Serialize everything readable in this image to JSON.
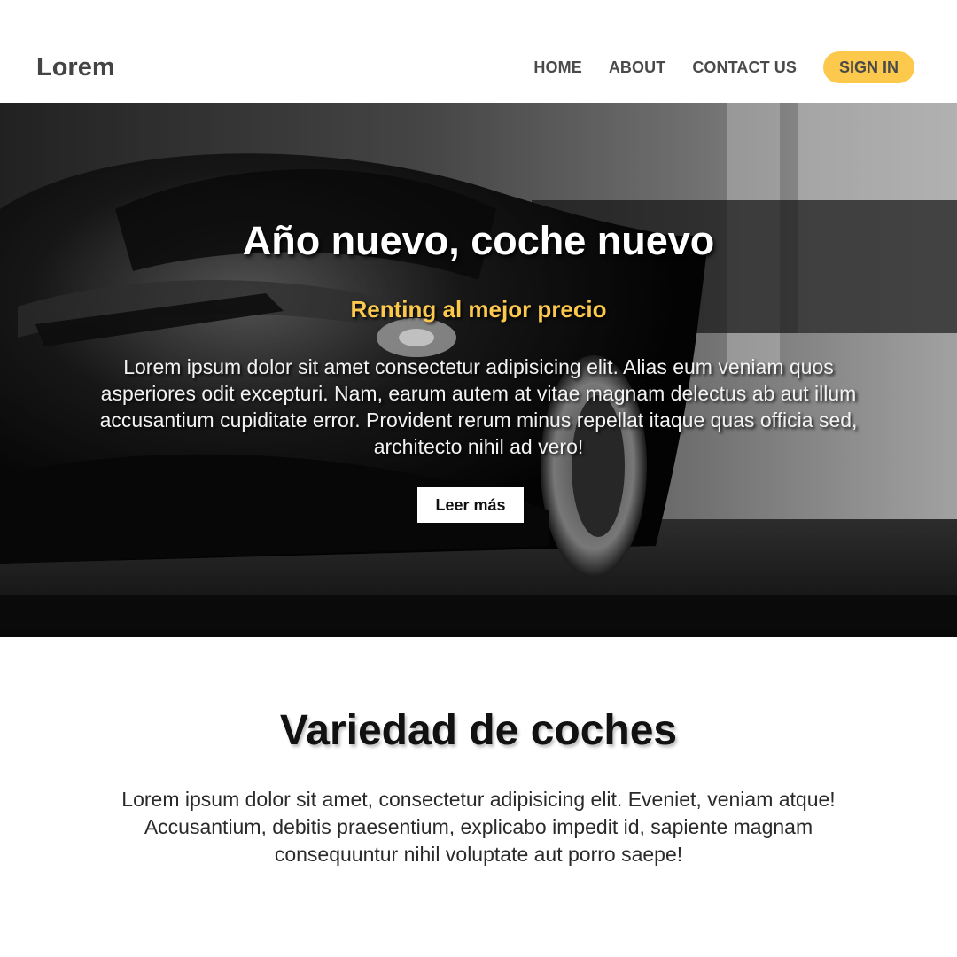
{
  "header": {
    "logo": "Lorem",
    "nav": [
      {
        "label": "HOME"
      },
      {
        "label": "ABOUT"
      },
      {
        "label": "CONTACT US"
      }
    ],
    "signin_label": "SIGN IN"
  },
  "hero": {
    "title": "Año nuevo, coche nuevo",
    "subtitle": "Renting al mejor precio",
    "text": "Lorem ipsum dolor sit amet consectetur adipisicing elit. Alias eum veniam quos asperiores odit excepturi. Nam, earum autem at vitae magnam delectus ab aut illum accusantium cupiditate error. Provident rerum minus repellat itaque quas officia sed, architecto nihil ad vero!",
    "button_label": "Leer más",
    "background_image": "black-sports-car-photo"
  },
  "section": {
    "title": "Variedad de coches",
    "text": "Lorem ipsum dolor sit amet, consectetur adipisicing elit. Eveniet, veniam atque! Accusantium, debitis praesentium, explicabo impedit id, sapiente magnam consequuntur nihil voluptate aut porro saepe!"
  },
  "colors": {
    "accent": "#fdc94c",
    "header_text": "#444444",
    "hero_overlay": "#1a1a1a"
  }
}
